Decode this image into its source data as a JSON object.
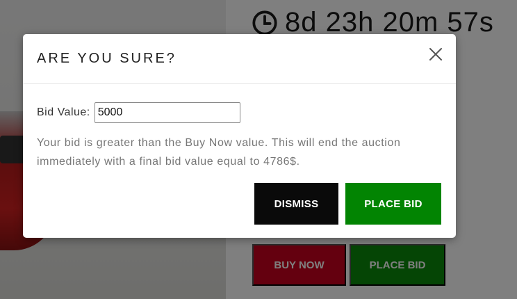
{
  "countdown": {
    "text": "8d 23h 20m 57s",
    "icon": "clock-icon"
  },
  "background_buttons": {
    "buy_now": "BUY NOW",
    "place_bid": "PLACE BID"
  },
  "modal": {
    "title": "ARE YOU SURE?",
    "close_icon": "close-icon",
    "bid_label": "Bid Value:",
    "bid_value": "5000",
    "warning": "Your bid is greater than the Buy Now value. This will end the auction immediately with a final bid value equal to 4786$.",
    "dismiss_label": "DISMISS",
    "place_bid_label": "PLACE BID"
  },
  "colors": {
    "dismiss_bg": "#0a0a0a",
    "place_bid_bg": "#028402",
    "buy_now_bg": "#c8001e"
  }
}
